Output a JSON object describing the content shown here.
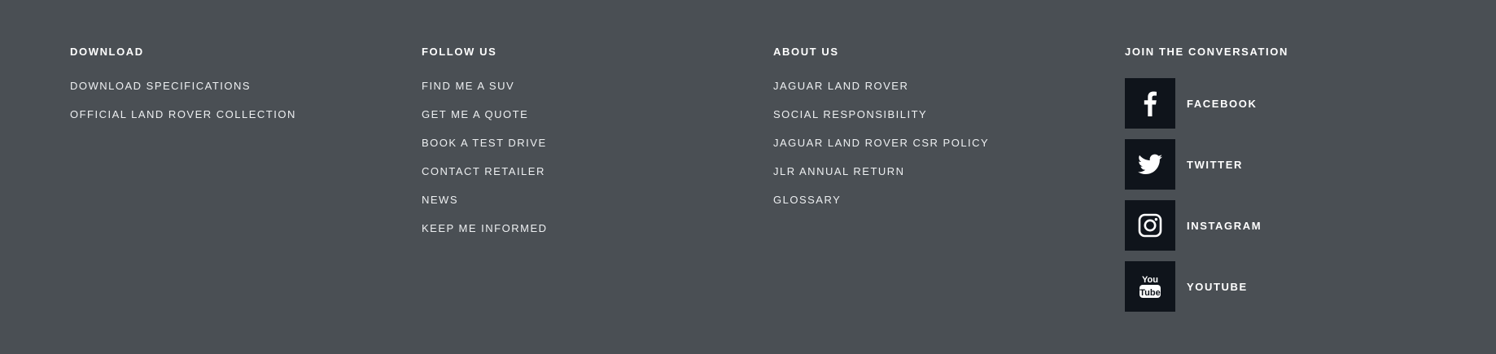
{
  "download": {
    "heading": "DOWNLOAD",
    "links": [
      "DOWNLOAD SPECIFICATIONS",
      "OFFICIAL LAND ROVER COLLECTION"
    ]
  },
  "follow": {
    "heading": "FOLLOW US",
    "links": [
      "FIND ME A SUV",
      "GET ME A QUOTE",
      "BOOK A TEST DRIVE",
      "CONTACT RETAILER",
      "NEWS",
      "KEEP ME INFORMED"
    ]
  },
  "about": {
    "heading": "ABOUT US",
    "links": [
      "JAGUAR LAND ROVER",
      "SOCIAL RESPONSIBILITY",
      "JAGUAR LAND ROVER CSR POLICY",
      "JLR ANNUAL RETURN",
      "GLOSSARY"
    ]
  },
  "social": {
    "heading": "JOIN THE CONVERSATION",
    "items": [
      {
        "label": "FACEBOOK",
        "icon": "facebook-icon"
      },
      {
        "label": "TWITTER",
        "icon": "twitter-icon"
      },
      {
        "label": "INSTAGRAM",
        "icon": "instagram-icon"
      },
      {
        "label": "YOUTUBE",
        "icon": "youtube-icon"
      }
    ],
    "youtube_logo_text": [
      "You",
      "Tube"
    ]
  },
  "colors": {
    "background": "#4a4f54",
    "icon_box": "#0f141b",
    "text": "#ffffff"
  }
}
